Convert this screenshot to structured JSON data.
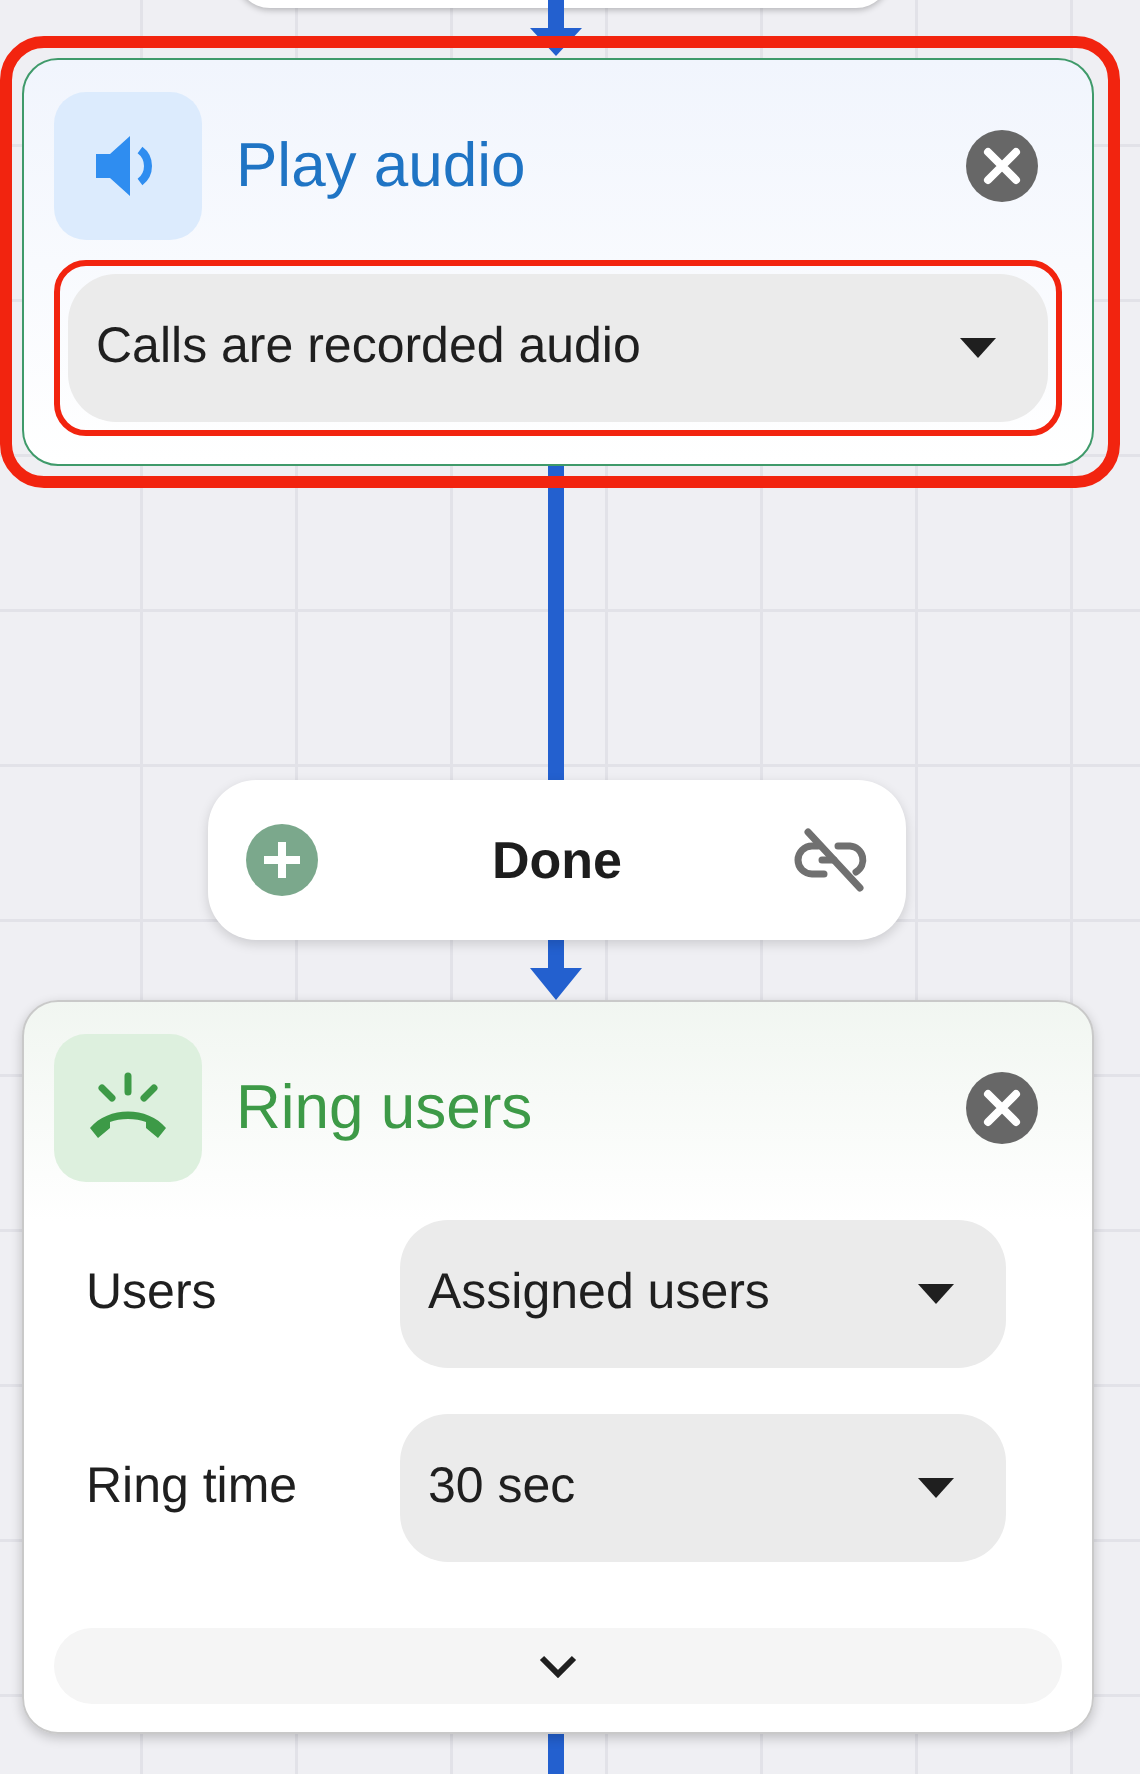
{
  "nodes": [
    {
      "kind": "play_audio",
      "title": "Play audio",
      "color": "#1f74c4",
      "selected": true,
      "fields": [
        {
          "value": "Calls are recorded audio",
          "selected": true
        }
      ]
    },
    {
      "kind": "connector",
      "label": "Done"
    },
    {
      "kind": "ring_users",
      "title": "Ring users",
      "color": "#3d9a47",
      "selected": false,
      "fields": [
        {
          "label": "Users",
          "value": "Assigned users",
          "selected": false
        },
        {
          "label": "Ring time",
          "value": "30 sec",
          "selected": false
        }
      ]
    }
  ]
}
